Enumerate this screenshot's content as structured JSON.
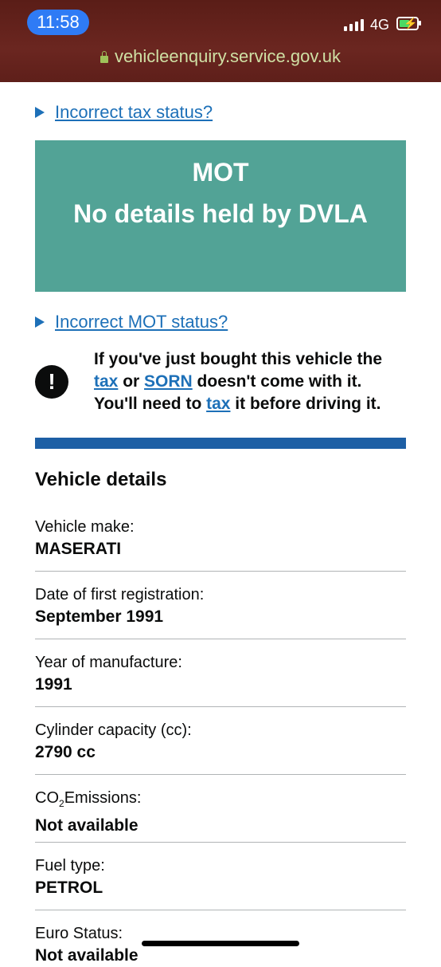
{
  "status_bar": {
    "time": "11:58",
    "network": "4G"
  },
  "browser": {
    "url": "vehicleenquiry.service.gov.uk"
  },
  "links": {
    "tax_status": "Incorrect tax status?",
    "mot_status": "Incorrect MOT status?"
  },
  "mot": {
    "title": "MOT",
    "message": "No details held by DVLA"
  },
  "warning": {
    "line1": "If you've just bought this vehicle the",
    "tax_link": "tax",
    "or": " or ",
    "sorn_link": "SORN",
    "line2_end": " doesn't come with it.",
    "line3_start": "You'll need to ",
    "tax_link2": "tax",
    "line3_end": " it before driving it."
  },
  "vehicle_details": {
    "title": "Vehicle details",
    "items": [
      {
        "label": "Vehicle make:",
        "value": "MASERATI"
      },
      {
        "label": "Date of first registration:",
        "value": "September 1991"
      },
      {
        "label": "Year of manufacture:",
        "value": "1991"
      },
      {
        "label": "Cylinder capacity (cc):",
        "value": "2790 cc"
      },
      {
        "label_prefix": "CO",
        "label_sub": "2",
        "label_suffix": "Emissions:",
        "value": "Not available"
      },
      {
        "label": "Fuel type:",
        "value": "PETROL"
      },
      {
        "label": "Euro Status:",
        "value": "Not available"
      }
    ]
  }
}
